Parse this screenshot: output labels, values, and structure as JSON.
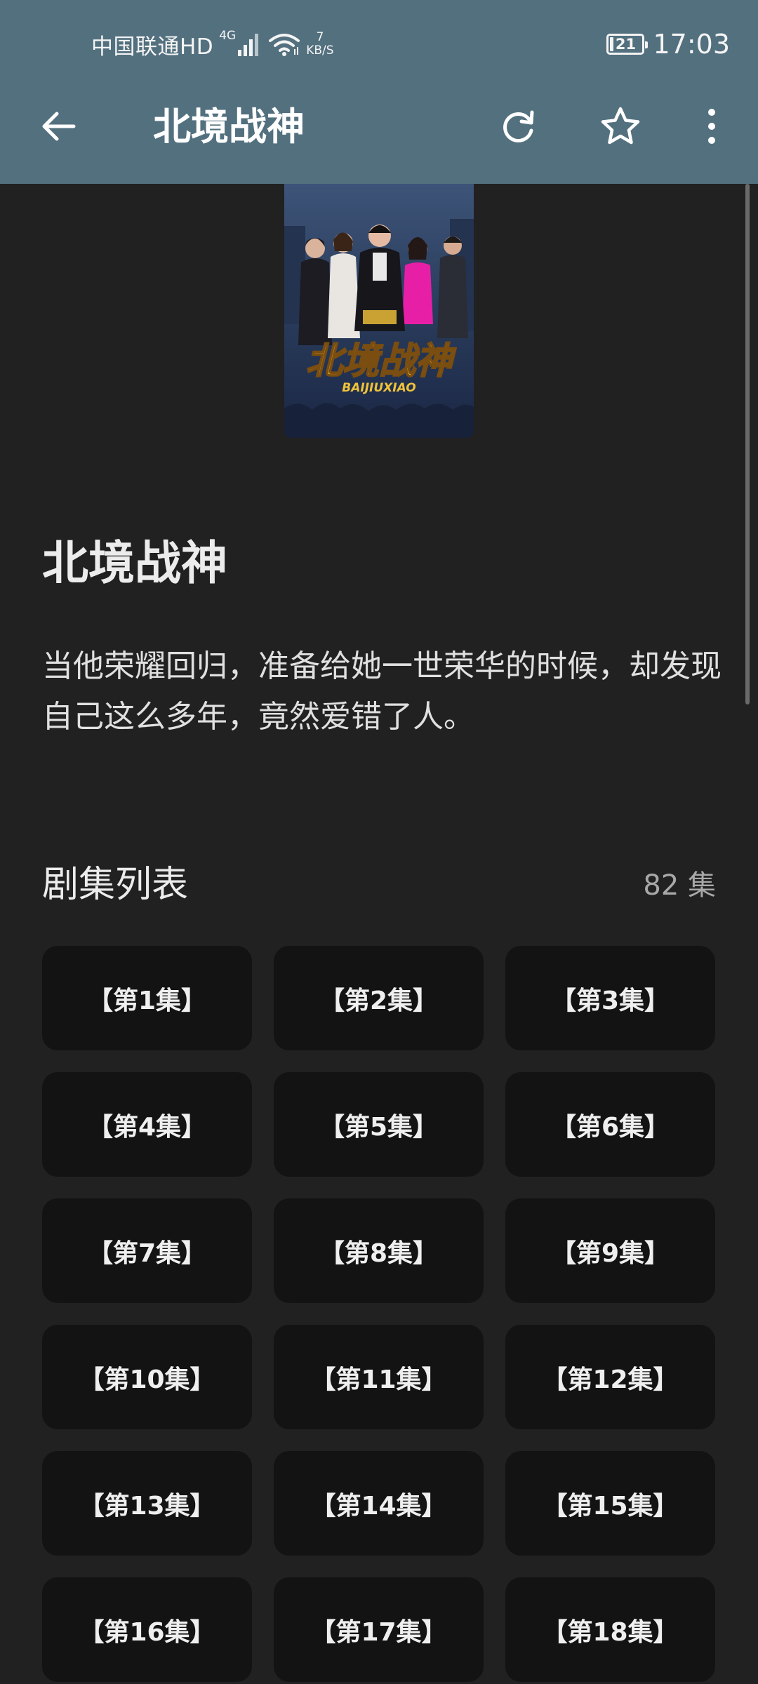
{
  "status_bar": {
    "carrier": "中国联通HD",
    "network_type": "4G",
    "speed_value": "7",
    "speed_unit": "KB/S",
    "battery_level": "21",
    "time": "17:03"
  },
  "toolbar": {
    "title": "北境战神",
    "icons": [
      "back-arrow-icon",
      "refresh-icon",
      "star-icon",
      "more-vertical-icon"
    ]
  },
  "drama": {
    "title": "北境战神",
    "description": "当他荣耀回归，准备给她一世荣华的时候，却发现自己这么多年，竟然爱错了人。",
    "poster": {
      "title_text": "北境战神",
      "subtitle_text": "BAIJIUXIAO"
    }
  },
  "episodes": {
    "section_title": "剧集列表",
    "count_label": "82 集",
    "items": [
      "【第1集】",
      "【第2集】",
      "【第3集】",
      "【第4集】",
      "【第5集】",
      "【第6集】",
      "【第7集】",
      "【第8集】",
      "【第9集】",
      "【第10集】",
      "【第11集】",
      "【第12集】",
      "【第13集】",
      "【第14集】",
      "【第15集】",
      "【第16集】",
      "【第17集】",
      "【第18集】"
    ]
  },
  "colors": {
    "header_bg": "#53707f",
    "page_bg": "#212121",
    "episode_button_bg": "#131313",
    "poster_title": "#f0c23a"
  }
}
